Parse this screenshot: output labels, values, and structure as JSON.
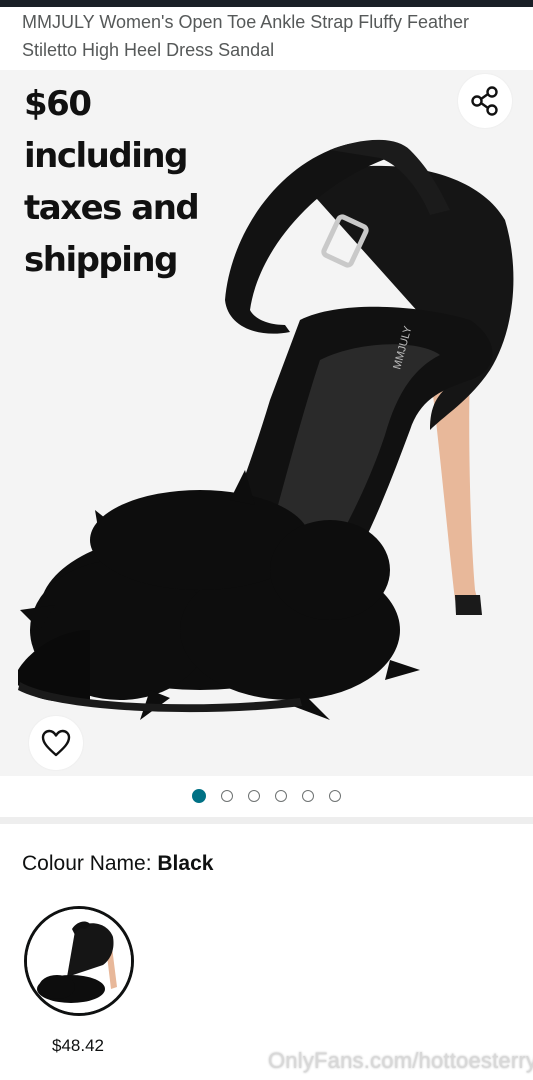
{
  "product": {
    "title": "MMJULY Women's Open Toe Ankle Strap Fluffy Feather Stiletto High Heel Dress Sandal",
    "image_brand_print": "MMJULY"
  },
  "gallery": {
    "overlay_text": "$60\nincluding\ntaxes and\nshipping",
    "image_count": 6,
    "active_index": 0,
    "share_icon": "share-icon",
    "wishlist_icon": "heart-outline-icon"
  },
  "variation": {
    "label": "Colour Name: ",
    "selected_value": "Black",
    "swatches": [
      {
        "price": "$48.42"
      }
    ]
  },
  "watermark": "OnlyFans.com/hottoesterry",
  "colors": {
    "dot_active": "#007185",
    "text_primary": "#0f1111",
    "text_secondary": "#565959",
    "gallery_bg": "#f4f4f4"
  }
}
